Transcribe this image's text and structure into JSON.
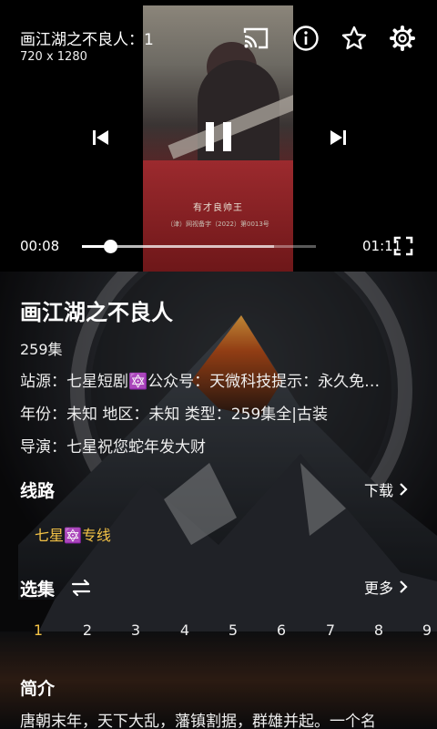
{
  "player": {
    "title": "画江湖之不良人：1",
    "resolution": "720 x 1280",
    "subtitle_main": "有才良帅王",
    "subtitle_small": "（津）网视备字（2022）第0013号",
    "time_current": "00:08",
    "time_total": "01:11",
    "progress_fraction": 0.12,
    "buffered_fraction": 0.82,
    "icons": [
      "cast-icon",
      "info-icon",
      "star-outline-icon",
      "gear-icon",
      "skip-previous-icon",
      "pause-icon",
      "skip-next-icon",
      "fullscreen-icon"
    ]
  },
  "details": {
    "title": "画江湖之不良人",
    "episodes": "259集",
    "info_line1": "站源：七星短剧🔯公众号：天微科技提示：永久免…",
    "info_line2": "年份：未知 地区：未知 类型：259集全|古装",
    "info_line3": "导演：七星祝您蛇年发大财",
    "route_heading": "线路",
    "download_label": "下载",
    "route_option": "七星🔯专线",
    "episodes_heading": "选集",
    "more_label": "更多",
    "episode_numbers": [
      "1",
      "2",
      "3",
      "4",
      "5",
      "6",
      "7",
      "8",
      "9"
    ],
    "intro_heading": "简介",
    "intro_text": "唐朝末年，天下大乱，藩镇割据，群雄并起。一个名"
  },
  "colors": {
    "accent": "#f3c246",
    "background": "#000000"
  }
}
